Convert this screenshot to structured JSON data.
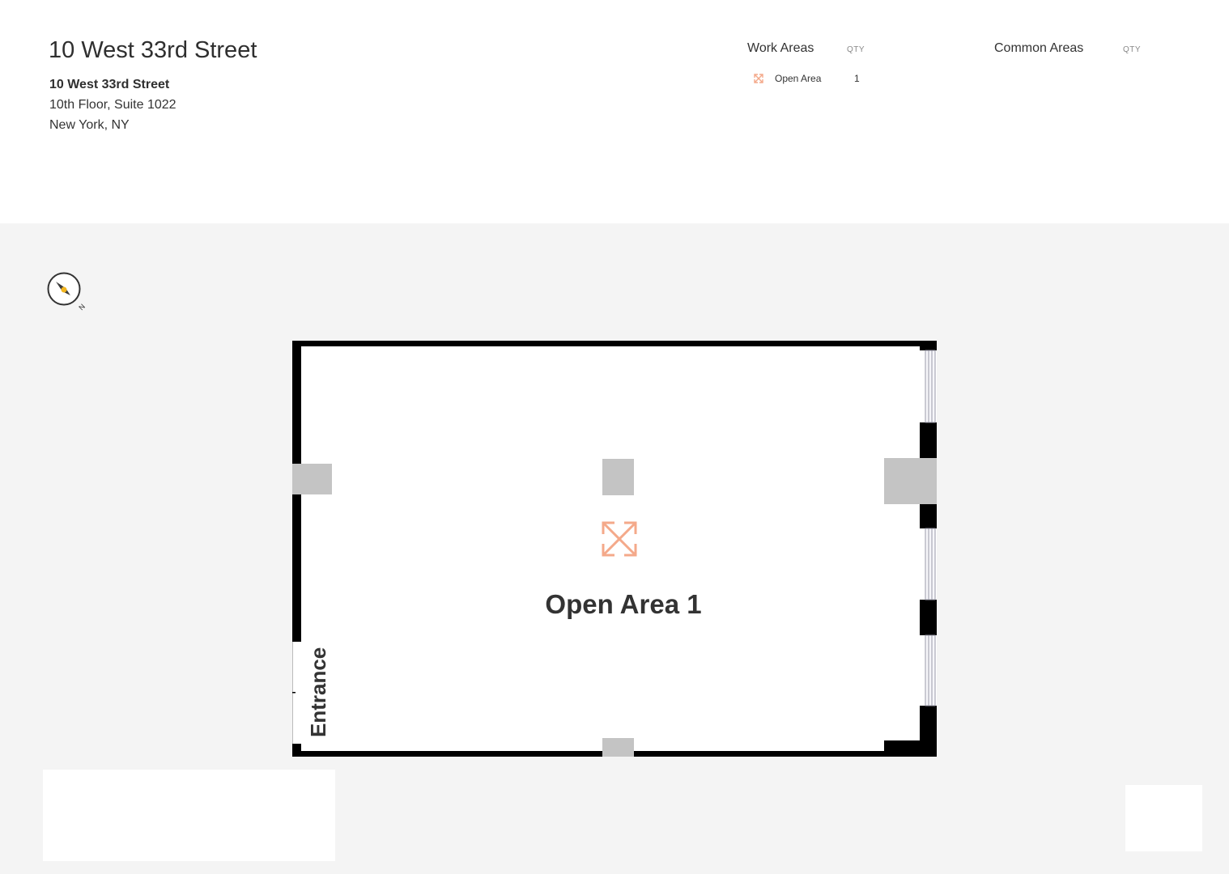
{
  "header": {
    "title": "10 West 33rd Street",
    "address": {
      "name": "10 West 33rd Street",
      "line1": "10th Floor, Suite 1022",
      "line2": "New York, NY"
    }
  },
  "legend": {
    "work_areas": {
      "heading": "Work Areas",
      "qty_label": "QTY",
      "items": [
        {
          "icon": "expand-arrows-icon",
          "label": "Open Area",
          "qty": "1"
        }
      ]
    },
    "common_areas": {
      "heading": "Common Areas",
      "qty_label": "QTY",
      "items": []
    }
  },
  "compass": {
    "label": "N"
  },
  "floorplan": {
    "room_label": "Open Area 1",
    "entrance_label": "Entrance",
    "accent_color": "#f4a98a",
    "wall_color": "#000000",
    "column_color": "#c4c4c4"
  }
}
